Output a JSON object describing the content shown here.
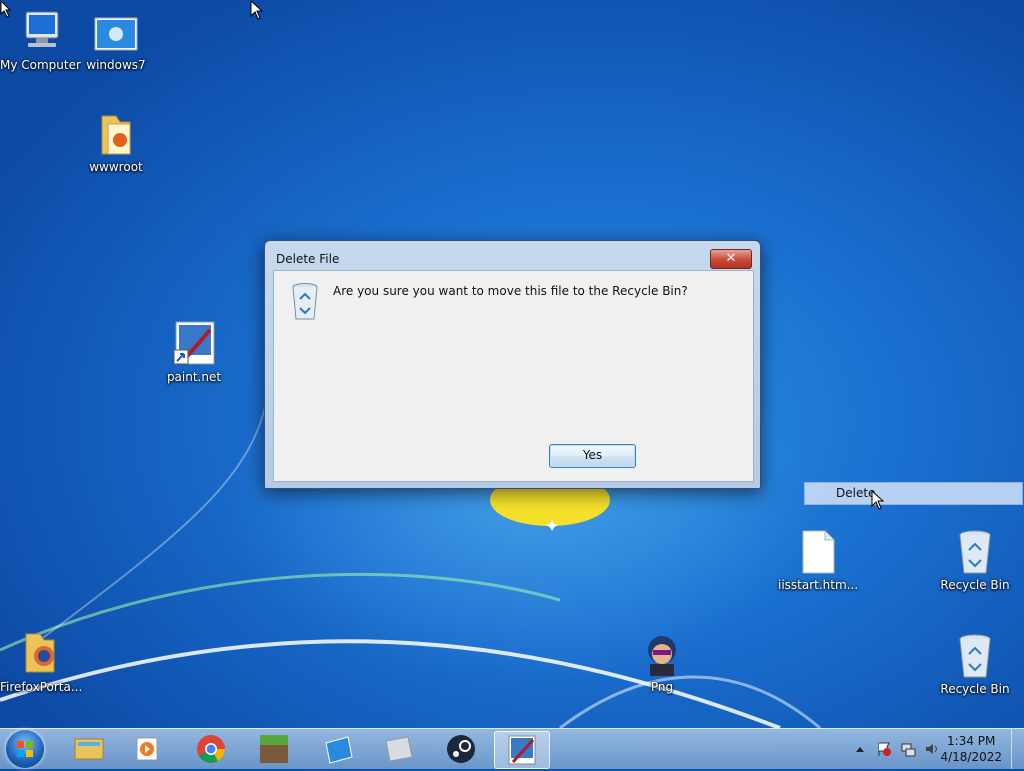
{
  "desktop": {
    "icons": {
      "my_computer": "My Computer",
      "windows7": "windows7",
      "wwwroot": "wwwroot",
      "paintnet": "paint.net",
      "firefox_portable": "FirefoxPorta...",
      "png": "Png",
      "iisstart": "iisstart.htm...",
      "recycle_bin_1": "Recycle Bin",
      "recycle_bin_2": "Recycle Bin"
    }
  },
  "dialog": {
    "title": "Delete File",
    "close_label": "✕",
    "message": "Are you sure you want to move this file to the Recycle Bin?",
    "yes_label": "Yes"
  },
  "context_menu": {
    "delete_label": "Delete"
  },
  "taskbar": {
    "pinned": [
      "file-explorer-icon",
      "media-player-icon",
      "chrome-icon",
      "minecraft-icon",
      "roblox-icon",
      "app-icon",
      "steam-icon",
      "paintnet-icon"
    ],
    "clock_time": "1:34 PM",
    "clock_date": "4/18/2022"
  },
  "colors": {
    "desktop_blue": "#1a6fcf",
    "close_red": "#c64a37",
    "button_border": "#3c7fb1"
  }
}
